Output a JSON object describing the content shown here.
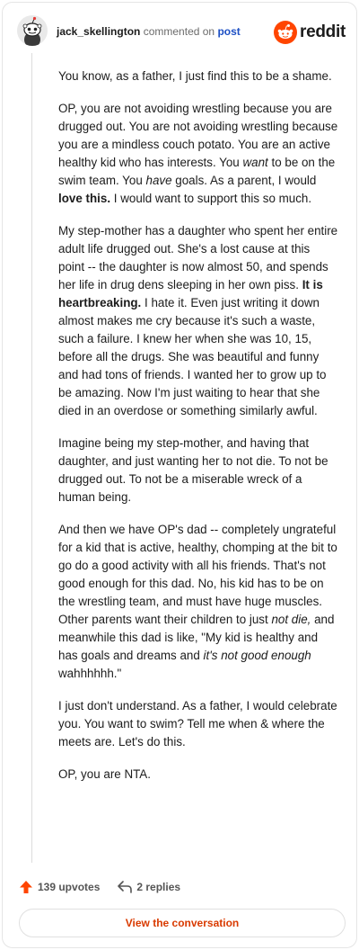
{
  "header": {
    "username": "jack_skellington",
    "commented_on": "commented on",
    "post_link": "post",
    "brand": "reddit"
  },
  "comment": {
    "paragraphs": [
      [
        {
          "t": "You know, as a father, I just find this to be a shame."
        }
      ],
      [
        {
          "t": "OP, you are not avoiding wrestling because you are drugged out. You are not avoiding wrestling because you are a mindless couch potato. You are an active healthy kid who has interests. You "
        },
        {
          "t": "want",
          "s": "i"
        },
        {
          "t": " to be on the swim team. You "
        },
        {
          "t": "have",
          "s": "i"
        },
        {
          "t": " goals. As a parent, I would "
        },
        {
          "t": "love this.",
          "s": "b"
        },
        {
          "t": " I would want to support this so much."
        }
      ],
      [
        {
          "t": "My step-mother has a daughter who spent her entire adult life drugged out. She's a lost cause at this point -- the daughter is now almost 50, and spends her life in drug dens sleeping in her own piss. "
        },
        {
          "t": "It is heartbreaking.",
          "s": "b"
        },
        {
          "t": " I hate it. Even just writing it down almost makes me cry because it's such a waste, such a failure. I knew her when she was 10, 15, before all the drugs. She was beautiful and funny and had tons of friends. I wanted her to grow up to be amazing. Now I'm just waiting to hear that she died in an overdose or something similarly awful."
        }
      ],
      [
        {
          "t": "Imagine being my step-mother, and having that daughter, and just wanting her to not die. To not be drugged out. To not be a miserable wreck of a human being."
        }
      ],
      [
        {
          "t": "And then we have OP's dad -- completely ungrateful for a kid that is active, healthy, chomping at the bit to go do a good activity with all his friends. That's not good enough for this dad. No, his kid has to be on the wrestling team, and must have huge muscles. Other parents want their children to just "
        },
        {
          "t": "not die,",
          "s": "i"
        },
        {
          "t": " and meanwhile this dad is like, \"My kid is healthy and has goals and dreams and "
        },
        {
          "t": "it's not good enough",
          "s": "i"
        },
        {
          "t": " wahhhhhh.\""
        }
      ],
      [
        {
          "t": "I just don't understand. As a father, I would celebrate you. You want to swim? Tell me when & where the meets are. Let's do this."
        }
      ],
      [
        {
          "t": "OP, you are NTA."
        }
      ]
    ]
  },
  "actions": {
    "upvotes": "139 upvotes",
    "replies": "2 replies"
  },
  "cta": {
    "label": "View the conversation"
  },
  "colors": {
    "brand_orange": "#ff4500",
    "link_blue": "#1c4fc4",
    "cta_text": "#d93a00"
  },
  "icons": {
    "avatar": "snoo-avatar-icon",
    "brand": "reddit-logo-icon",
    "upvote": "upvote-arrow-icon",
    "reply": "reply-arrow-icon"
  }
}
